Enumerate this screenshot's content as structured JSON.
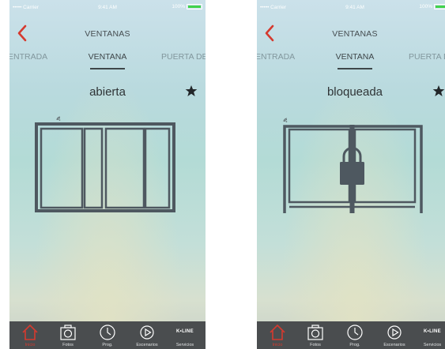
{
  "status": {
    "carrier": "••••• Carrier",
    "time": "9:41 AM",
    "battery": "100%"
  },
  "nav": {
    "title": "VENTANAS"
  },
  "tabs": {
    "left": "ENTRADA",
    "center": "VENTANA",
    "right": "PUERTA DE"
  },
  "screens": [
    {
      "state": "abierta",
      "window_state": "open"
    },
    {
      "state": "bloqueada",
      "window_state": "locked"
    }
  ],
  "tabbar": {
    "home": "Inicio",
    "photos": "Fotos",
    "prog": "Prog.",
    "scenes": "Escenarios",
    "brand": "K•LINE",
    "services": "Servicios"
  },
  "colors": {
    "accent": "#d53a2f",
    "frame": "#4e5860",
    "tabbar": "#4a4d4f",
    "battery": "#41d34b"
  },
  "icons": [
    "back-chevron-icon",
    "star-icon",
    "wifi-icon",
    "home-icon",
    "camera-icon",
    "clock-icon",
    "play-icon",
    "padlock-icon"
  ]
}
